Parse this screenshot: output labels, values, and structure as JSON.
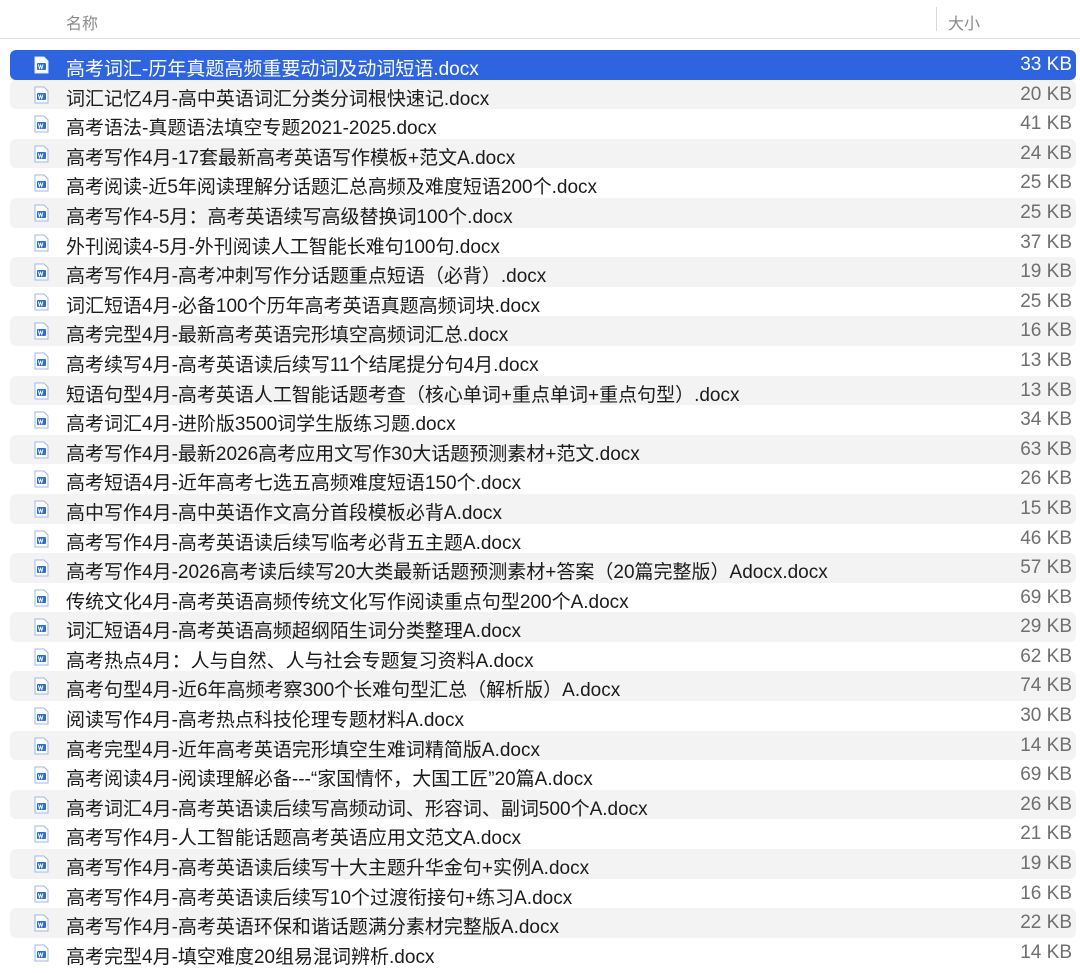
{
  "columns": {
    "name": "名称",
    "size": "大小"
  },
  "files": [
    {
      "name": "高考词汇-历年真题高频重要动词及动词短语.docx",
      "size": "33 KB",
      "selected": true,
      "icon": "word-doc-icon"
    },
    {
      "name": "词汇记忆4月-高中英语词汇分类分词根快速记.docx",
      "size": "20 KB",
      "icon": "word-doc-icon"
    },
    {
      "name": "高考语法-真题语法填空专题2021-2025.docx",
      "size": "41 KB",
      "icon": "word-doc-icon"
    },
    {
      "name": "高考写作4月-17套最新高考英语写作模板+范文A.docx",
      "size": "24 KB",
      "icon": "word-doc-icon"
    },
    {
      "name": "高考阅读-近5年阅读理解分话题汇总高频及难度短语200个.docx",
      "size": "25 KB",
      "icon": "word-doc-icon"
    },
    {
      "name": "高考写作4-5月：高考英语续写高级替换词100个.docx",
      "size": "25 KB",
      "icon": "word-doc-icon"
    },
    {
      "name": "外刊阅读4-5月-外刊阅读人工智能长难句100句.docx",
      "size": "37 KB",
      "icon": "word-doc-icon"
    },
    {
      "name": "高考写作4月-高考冲刺写作分话题重点短语（必背）.docx",
      "size": "19 KB",
      "icon": "word-doc-icon"
    },
    {
      "name": "词汇短语4月-必备100个历年高考英语真题高频词块.docx",
      "size": "25 KB",
      "icon": "word-doc-icon"
    },
    {
      "name": "高考完型4月-最新高考英语完形填空高频词汇总.docx",
      "size": "16 KB",
      "icon": "word-doc-icon"
    },
    {
      "name": "高考续写4月-高考英语读后续写11个结尾提分句4月.docx",
      "size": "13 KB",
      "icon": "word-doc-icon"
    },
    {
      "name": "短语句型4月-高考英语人工智能话题考查（核心单词+重点单词+重点句型）.docx",
      "size": "13 KB",
      "icon": "word-doc-icon"
    },
    {
      "name": "高考词汇4月-进阶版3500词学生版练习题.docx",
      "size": "34 KB",
      "icon": "word-doc-icon"
    },
    {
      "name": "高考写作4月-最新2026高考应用文写作30大话题预测素材+范文.docx",
      "size": "63 KB",
      "icon": "word-doc-icon"
    },
    {
      "name": "高考短语4月-近年高考七选五高频难度短语150个.docx",
      "size": "26 KB",
      "icon": "word-doc-icon"
    },
    {
      "name": "高中写作4月-高中英语作文高分首段模板必背A.docx",
      "size": "15 KB",
      "icon": "word-doc-icon"
    },
    {
      "name": "高考写作4月-高考英语读后续写临考必背五主题A.docx",
      "size": "46 KB",
      "icon": "word-doc-icon"
    },
    {
      "name": "高考写作4月-2026高考读后续写20大类最新话题预测素材+答案（20篇完整版）Adocx.docx",
      "size": "57 KB",
      "icon": "word-doc-icon"
    },
    {
      "name": "传统文化4月-高考英语高频传统文化写作阅读重点句型200个A.docx",
      "size": "69 KB",
      "icon": "word-doc-icon"
    },
    {
      "name": "词汇短语4月-高考英语高频超纲陌生词分类整理A.docx",
      "size": "29 KB",
      "icon": "word-doc-icon"
    },
    {
      "name": "高考热点4月：人与自然、人与社会专题复习资料A.docx",
      "size": "62 KB",
      "icon": "word-doc-icon"
    },
    {
      "name": "高考句型4月-近6年高频考察300个长难句型汇总（解析版）A.docx",
      "size": "74 KB",
      "icon": "word-doc-icon"
    },
    {
      "name": "阅读写作4月-高考热点科技伦理专题材料A.docx",
      "size": "30 KB",
      "icon": "word-doc-icon"
    },
    {
      "name": "高考完型4月-近年高考英语完形填空生难词精简版A.docx",
      "size": "14 KB",
      "icon": "word-doc-icon"
    },
    {
      "name": "高考阅读4月-阅读理解必备---“家国情怀，大国工匠”20篇A.docx",
      "size": "69 KB",
      "icon": "word-doc-icon"
    },
    {
      "name": "高考词汇4月-高考英语读后续写高频动词、形容词、副词500个A.docx",
      "size": "26 KB",
      "icon": "word-doc-icon"
    },
    {
      "name": "高考写作4月-人工智能话题高考英语应用文范文A.docx",
      "size": "21 KB",
      "icon": "word-doc-icon"
    },
    {
      "name": "高考写作4月-高考英语读后续写十大主题升华金句+实例A.docx",
      "size": "19 KB",
      "icon": "word-doc-icon"
    },
    {
      "name": "高考写作4月-高考英语读后续写10个过渡衔接句+练习A.docx",
      "size": "16 KB",
      "icon": "word-doc-icon"
    },
    {
      "name": "高考写作4月-高考英语环保和谐话题满分素材完整版A.docx",
      "size": "22 KB",
      "icon": "word-doc-icon"
    },
    {
      "name": "高考完型4月-填空难度20组易混词辨析.docx",
      "size": "14 KB",
      "icon": "word-doc-icon"
    }
  ],
  "colors": {
    "selection": "#2f64e0",
    "stripe": "#f3f3f3",
    "icon_blue": "#2b6fd6"
  }
}
